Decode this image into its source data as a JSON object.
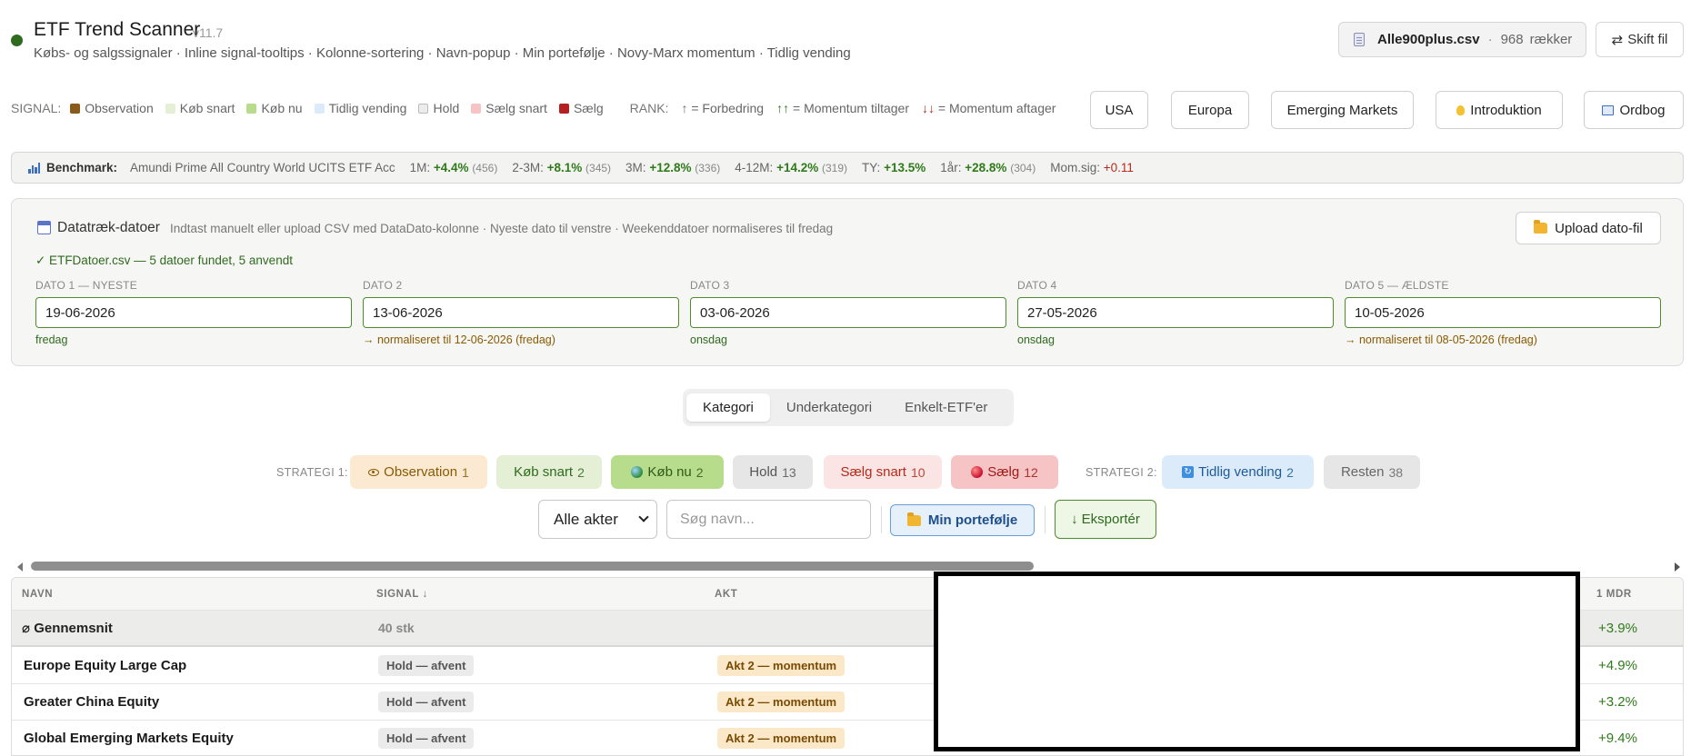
{
  "header": {
    "title": "ETF Trend Scanner",
    "version": "v11.7",
    "subtitle": "Købs- og salgssignaler · Inline signal-tooltips · Kolonne-sortering · Navn-popup · Min portefølje · Novy-Marx momentum · Tidlig vending",
    "file_name": "Alle900plus.csv",
    "file_sep": "·",
    "row_count": "968",
    "rows_label": "rækker",
    "switch_file_label": "Skift fil",
    "status_color": "#2f6b1e"
  },
  "legend": {
    "signal_label": "SIGNAL:",
    "items": [
      {
        "label": "Observation",
        "color": "#8a5a1a"
      },
      {
        "label": "Køb snart",
        "color": "#e4efd6"
      },
      {
        "label": "Køb nu",
        "color": "#b6dc8c"
      },
      {
        "label": "Tidlig vending",
        "color": "#dcebfa"
      },
      {
        "label": "Hold",
        "color": "#ececec"
      },
      {
        "label": "Sælg snart",
        "color": "#f6c4c4"
      },
      {
        "label": "Sælg",
        "color": "#b32020"
      }
    ],
    "rank_label": "RANK:",
    "rank_items": [
      {
        "arrow": "↑",
        "text": "= Forbedring"
      },
      {
        "arrow": "↑↑",
        "text": "= Momentum tiltager"
      },
      {
        "arrow": "↓↓",
        "text": "= Momentum aftager"
      }
    ]
  },
  "regions": [
    "USA",
    "Europa",
    "Emerging Markets"
  ],
  "intro_label": "Introduktion",
  "glossary_label": "Ordbog",
  "benchmark": {
    "title": "Benchmark:",
    "fund": "Amundi Prime All Country World UCITS ETF Acc",
    "stats": [
      {
        "label": "1M:",
        "value": "+4.4%",
        "n": "(456)"
      },
      {
        "label": "2-3M:",
        "value": "+8.1%",
        "n": "(345)"
      },
      {
        "label": "3M:",
        "value": "+12.8%",
        "n": "(336)"
      },
      {
        "label": "4-12M:",
        "value": "+14.2%",
        "n": "(319)"
      },
      {
        "label": "TY:",
        "value": "+13.5%",
        "n": ""
      },
      {
        "label": "1år:",
        "value": "+28.8%",
        "n": "(304)"
      }
    ],
    "mom_label": "Mom.sig:",
    "mom_value": "+0.11"
  },
  "dates_panel": {
    "title": "Datatræk-datoer",
    "description": "Indtast manuelt eller upload CSV med DataDato-kolonne · Nyeste dato til venstre · Weekenddatoer normaliseres til fredag",
    "upload_label": "Upload dato-fil",
    "found_line": "✓ ETFDatoer.csv — 5 datoer fundet, 5 anvendt",
    "dates": [
      {
        "label": "DATO 1 — NYESTE",
        "value": "19-06-2026",
        "note": "fredag",
        "warn": false
      },
      {
        "label": "DATO 2",
        "value": "13-06-2026",
        "note": "→ normaliseret til 12-06-2026 (fredag)",
        "warn": true
      },
      {
        "label": "DATO 3",
        "value": "03-06-2026",
        "note": "onsdag",
        "warn": false
      },
      {
        "label": "DATO 4",
        "value": "27-05-2026",
        "note": "onsdag",
        "warn": false
      },
      {
        "label": "DATO 5 — ÆLDSTE",
        "value": "10-05-2026",
        "note": "→ normaliseret til 08-05-2026 (fredag)",
        "warn": true
      }
    ]
  },
  "view_tabs": [
    "Kategori",
    "Underkategori",
    "Enkelt-ETF'er"
  ],
  "strategy": {
    "label1": "STRATEGI 1:",
    "label2": "STRATEGI 2:",
    "chips": [
      {
        "label": "Observation",
        "count": "1"
      },
      {
        "label": "Køb snart",
        "count": "2"
      },
      {
        "label": "Køb nu",
        "count": "2"
      },
      {
        "label": "Hold",
        "count": "13"
      },
      {
        "label": "Sælg snart",
        "count": "10"
      },
      {
        "label": "Sælg",
        "count": "12"
      },
      {
        "label": "Tidlig vending",
        "count": "2"
      },
      {
        "label": "Resten",
        "count": "38"
      }
    ]
  },
  "filters": {
    "akt_value": "Alle akter",
    "search_placeholder": "Søg navn...",
    "portfolio_label": "Min portefølje",
    "export_label": "Eksportér"
  },
  "table": {
    "headers": {
      "name": "NAVN",
      "signal": "SIGNAL ↓",
      "akt": "AKT",
      "m1": "1 MDR"
    },
    "average": {
      "name": "⌀ Gennemsnit",
      "count": "40 stk",
      "m1": "+3.9%"
    },
    "rows": [
      {
        "name": "Europe Equity Large Cap",
        "signal": "Hold — afvent",
        "akt": "Akt 2 — momentum",
        "m1": "+4.9%"
      },
      {
        "name": "Greater China Equity",
        "signal": "Hold — afvent",
        "akt": "Akt 2 — momentum",
        "m1": "+3.2%"
      },
      {
        "name": "Global Emerging Markets Equity",
        "signal": "Hold — afvent",
        "akt": "Akt 2 — momentum",
        "m1": "+9.4%"
      }
    ]
  }
}
